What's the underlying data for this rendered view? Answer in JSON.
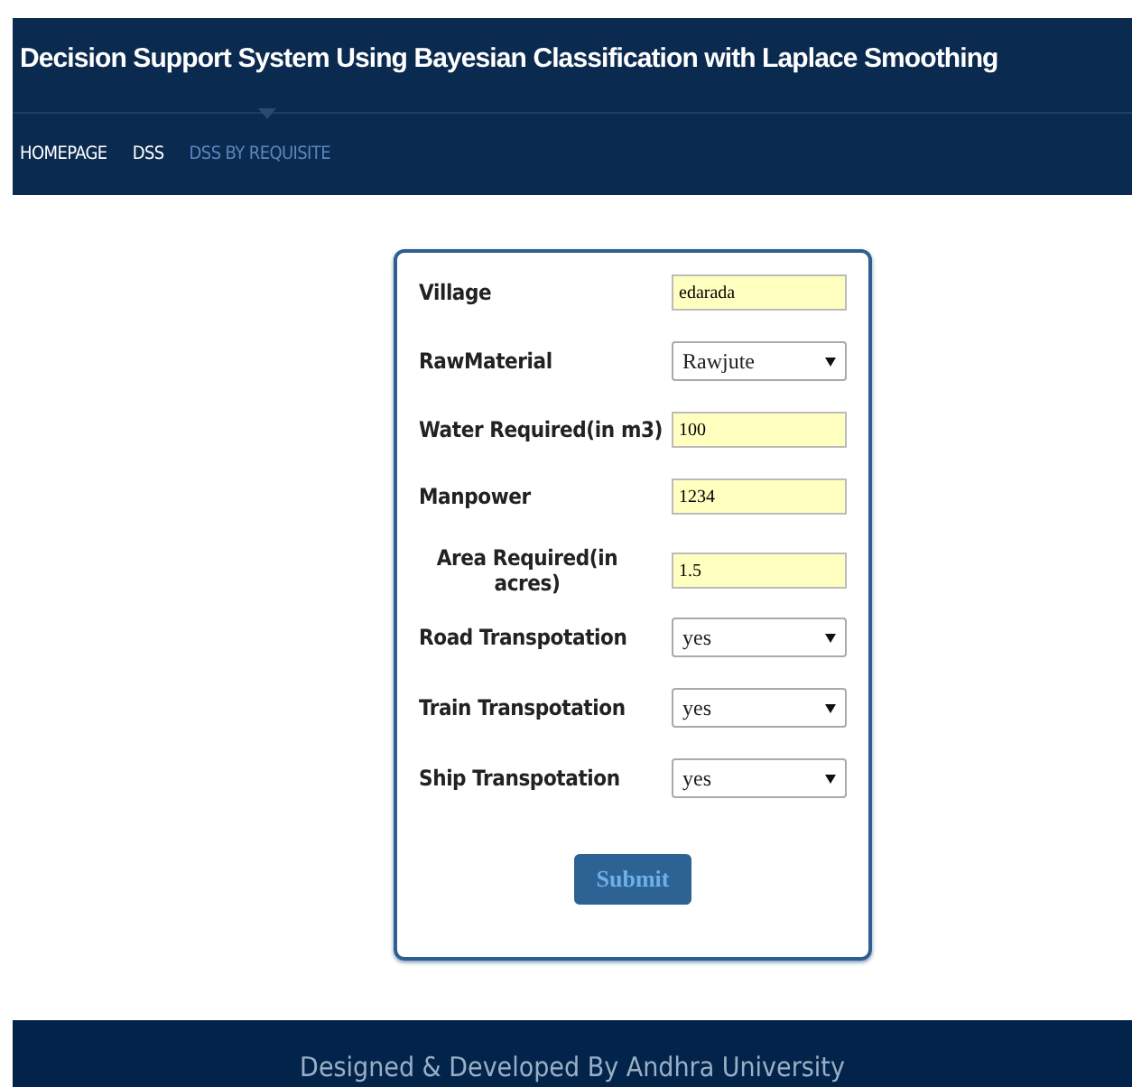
{
  "header": {
    "title": "Decision Support System Using Bayesian Classification with Laplace Smoothing"
  },
  "nav": [
    {
      "label": "HOMEPAGE",
      "selected": false
    },
    {
      "label": "DSS",
      "selected": false
    },
    {
      "label": "DSS BY REQUISITE",
      "selected": true
    }
  ],
  "form": {
    "fields": [
      {
        "kind": "text",
        "label": "Village",
        "value": "edarada"
      },
      {
        "kind": "select",
        "label": "RawMaterial",
        "value": "Rawjute"
      },
      {
        "kind": "text",
        "label": "Water Required(in m3)",
        "value": "100"
      },
      {
        "kind": "text",
        "label": "Manpower",
        "value": "1234"
      },
      {
        "kind": "text",
        "label": "Area Required(in acres)",
        "value": "1.5",
        "centered": true
      },
      {
        "kind": "select",
        "label": "Road Transpotation",
        "value": "yes"
      },
      {
        "kind": "select",
        "label": "Train Transpotation",
        "value": "yes"
      },
      {
        "kind": "select",
        "label": "Ship Transpotation",
        "value": "yes"
      }
    ],
    "submit": "Submit"
  },
  "footer": {
    "text": "Designed & Developed By Andhra University"
  }
}
